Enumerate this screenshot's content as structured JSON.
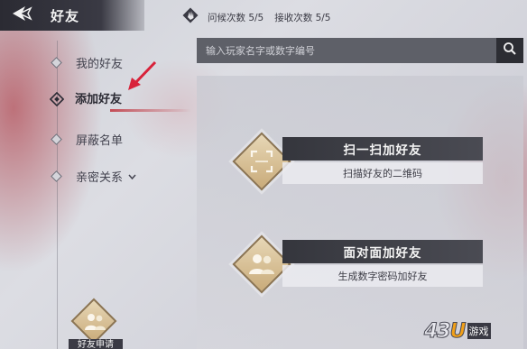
{
  "header": {
    "title": "好友"
  },
  "nav": {
    "items": [
      {
        "label": "我的好友"
      },
      {
        "label": "添加好友"
      },
      {
        "label": "屏蔽名单"
      },
      {
        "label": "亲密关系"
      }
    ],
    "active_index": 1
  },
  "topbar": {
    "greet": "问候次数 5/5",
    "receive": "接收次数 5/5"
  },
  "search": {
    "placeholder": "输入玩家名字或数字编号"
  },
  "actions": [
    {
      "title": "扫一扫加好友",
      "subtitle": "扫描好友的二维码",
      "icon": "scan-frame-icon"
    },
    {
      "title": "面对面加好友",
      "subtitle": "生成数字密码加好友",
      "icon": "two-people-icon"
    }
  ],
  "friend_request": {
    "label": "好友申请",
    "icon": "people-icon"
  },
  "watermark": {
    "logo_main": "43U",
    "logo_suffix": "游戏"
  },
  "colors": {
    "accent_gold": "#c9ab7a",
    "dark_bar": "#35363d",
    "red_marker": "#d8223a"
  }
}
